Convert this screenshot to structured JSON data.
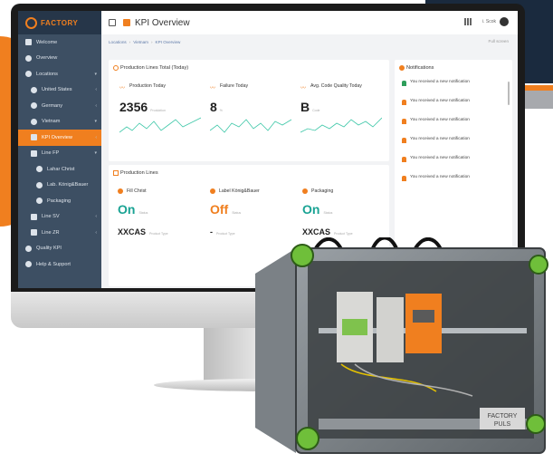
{
  "brand": {
    "name": "FACTORY"
  },
  "sidebar": {
    "items": [
      {
        "label": "Welcome",
        "icon": "home-icon"
      },
      {
        "label": "Overview",
        "icon": "globe-icon"
      },
      {
        "label": "Locations",
        "icon": "location-pin-icon"
      },
      {
        "label": "United States",
        "icon": "location-pin-icon"
      },
      {
        "label": "Germany",
        "icon": "location-pin-icon"
      },
      {
        "label": "Vietnam",
        "icon": "location-pin-icon"
      },
      {
        "label": "KPI Overview",
        "icon": "dashboard-icon"
      },
      {
        "label": "Line FP",
        "icon": "line-icon"
      },
      {
        "label": "Lahar Christ",
        "icon": "location-pin-icon"
      },
      {
        "label": "Lab. König&Bauer",
        "icon": "location-pin-icon"
      },
      {
        "label": "Packaging",
        "icon": "location-pin-icon"
      },
      {
        "label": "Line SV",
        "icon": "line-icon"
      },
      {
        "label": "Line ZR",
        "icon": "line-icon"
      },
      {
        "label": "Quality KPI",
        "icon": "quality-icon"
      },
      {
        "label": "Help & Support",
        "icon": "help-icon"
      }
    ]
  },
  "topbar": {
    "title": "KPI Overview",
    "user": "i. Scok"
  },
  "breadcrumb": {
    "items": [
      "Locations",
      "Vietnam",
      "KPI Overview"
    ],
    "fullscreen": "Full screen"
  },
  "production_card": {
    "title": "Production Lines Total (Today)",
    "kpis": [
      {
        "label": "Production Today",
        "value": "2356",
        "unit": "Produktion"
      },
      {
        "label": "Failure Today",
        "value": "8",
        "unit": "%"
      },
      {
        "label": "Avg. Code Quality Today",
        "value": "B",
        "unit": "Code"
      }
    ]
  },
  "lines_card": {
    "title": "Production Lines",
    "lines": [
      {
        "label": "Fill Christ",
        "state": "On",
        "state_note": "Status",
        "code": "XXCAS",
        "code_note": "Product Type"
      },
      {
        "label": "Label König&Bauer",
        "state": "Off",
        "state_note": "Status",
        "code": "-",
        "code_note": "Product Type"
      },
      {
        "label": "Packaging",
        "state": "On",
        "state_note": "Status",
        "code": "XXCAS",
        "code_note": "Product Type"
      }
    ]
  },
  "notifications": {
    "title": "Notifications",
    "items": [
      {
        "text": "You received a new notification",
        "time": ""
      },
      {
        "text": "You received a new notification",
        "time": ""
      },
      {
        "text": "You received a new notification",
        "time": ""
      },
      {
        "text": "You received a new notification",
        "time": ""
      },
      {
        "text": "You received a new notification",
        "time": ""
      },
      {
        "text": "You received a new notification",
        "time": ""
      }
    ]
  },
  "device_logo": "FACTORY PULS",
  "colors": {
    "accent": "#f07f1f",
    "on": "#1aa394",
    "off": "#f07f1f",
    "sidebar": "#3d4f63"
  }
}
